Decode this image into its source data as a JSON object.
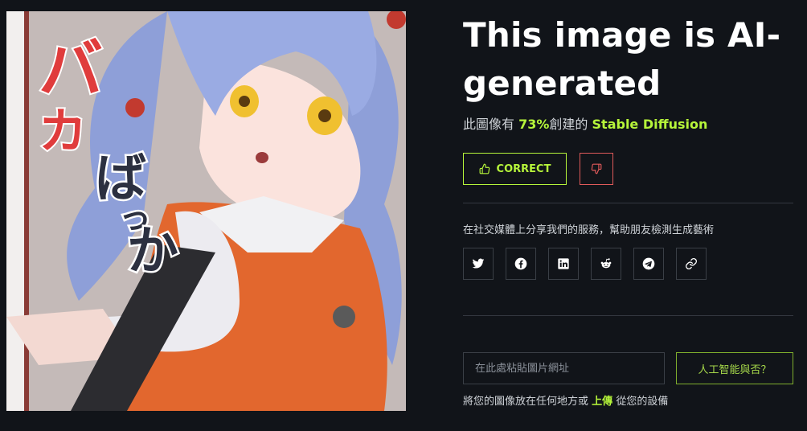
{
  "result": {
    "title": "This image is AI-generated",
    "prefix": "此圖像有",
    "percent": "73%",
    "middle": "創建的",
    "model": "Stable Diffusion"
  },
  "feedback": {
    "correct_label": "CORRECT",
    "correct_icon": "thumbs-up-icon",
    "wrong_icon": "thumbs-down-icon",
    "accent_color": "#b6f53a",
    "wrong_color": "#e05a5a"
  },
  "share": {
    "text": "在社交媒體上分享我們的服務，幫助朋友檢測生成藝術",
    "icons": [
      "twitter-icon",
      "facebook-icon",
      "linkedin-icon",
      "reddit-icon",
      "telegram-icon",
      "link-icon"
    ]
  },
  "check": {
    "placeholder": "在此處粘貼圖片網址",
    "button_label": "人工智能與否？"
  },
  "upload": {
    "prefix": "將您的圖像放在任何地方或",
    "link": "上傳",
    "suffix": "從您的設備"
  },
  "image": {
    "caption_text": "バカばっか",
    "subject_icon": "anime-girl-illustration"
  }
}
